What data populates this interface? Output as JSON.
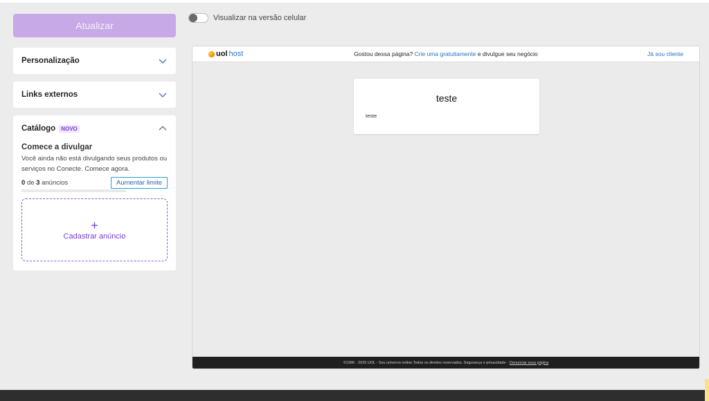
{
  "sidebar": {
    "update_button": "Atualizar",
    "personalizacao": "Personalização",
    "links_externos": "Links externos",
    "catalogo": {
      "title": "Catálogo",
      "badge": "NOVO",
      "subtitle": "Comece a divulgar",
      "description": "Você ainda não está divulgando seus produtos ou serviços no Conecte. Comece agora.",
      "count_used": "0",
      "count_sep": "de",
      "count_total": "3",
      "count_unit": "anúncios",
      "progress_fraction": 0,
      "increase_button": "Aumentar limite",
      "add_plus": "+",
      "add_label": "Cadastrar anúncio"
    }
  },
  "toggle": {
    "label": "Visualizar na versão celular",
    "on": false
  },
  "preview": {
    "logo_brand": "uol",
    "logo_host": "host",
    "message_prefix": "Gostou dessa página?",
    "message_link": "Crie uma gratuitamente",
    "message_suffix": "e divulgue seu negócio",
    "client_link": "Já sou cliente",
    "card_title": "teste",
    "card_text": "teste",
    "footer_text": "©1996 - 2025 UOL - Seu universo online.Todos os direitos reservados. Segurança e privacidade -",
    "footer_link": "Denunciar essa página"
  },
  "colors": {
    "accent_purple": "#8a4ee0",
    "update_button_bg": "#c6a9e6",
    "link_blue": "#2270c4"
  }
}
